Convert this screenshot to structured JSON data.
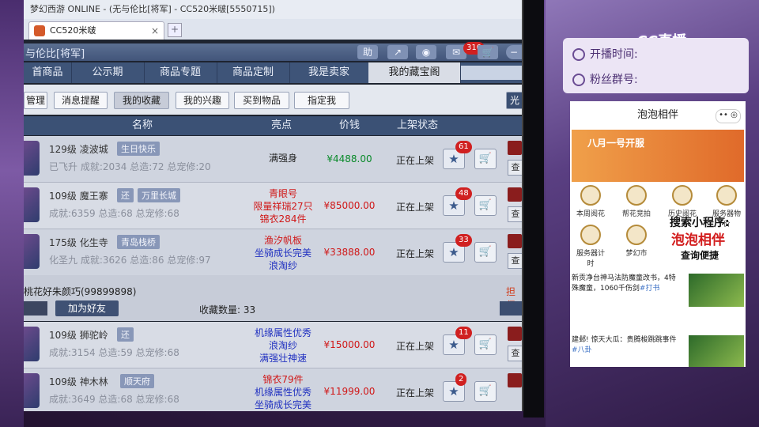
{
  "window": {
    "title": "梦幻西游 ONLINE - (无与伦比[将军] - CC520米啵[5550715])"
  },
  "browser": {
    "tab_label": "CC520米啵",
    "tab_close": "×",
    "new_tab": "+"
  },
  "game": {
    "server_title": "与伦比[将军]",
    "help_label": "助",
    "message_badge": "310"
  },
  "nav": {
    "items": [
      "首商品",
      "公示期",
      "商品专题",
      "商品定制",
      "我是卖家",
      "我的藏宝阁"
    ],
    "active_index": 5
  },
  "subnav": {
    "items": [
      "管理",
      "消息提醒",
      "我的收藏",
      "我的兴趣",
      "买到物品",
      "指定我"
    ],
    "selected_index": 2,
    "end_label": "光"
  },
  "table": {
    "headers": {
      "name": "名称",
      "highlight": "亮点",
      "price": "价钱",
      "status": "上架状态"
    },
    "rows": [
      {
        "level": "129级",
        "school": "凌波城",
        "tag": "生日快乐",
        "stats": "已飞升 成就:2034 总造:72 总宠修:20",
        "highlights": [
          "满强身"
        ],
        "price": "¥4488.00",
        "price_color": "#0a8a2a",
        "status": "正在上架",
        "favorites": "61"
      },
      {
        "level": "109级",
        "school": "魔王寨",
        "tag2": "还",
        "tag": "万里长城",
        "stats": "成就:6359 总造:68 总宠修:68",
        "highlights": [
          "青眼号",
          "限量祥瑞27只",
          "锦衣284件"
        ],
        "price": "¥85000.00",
        "price_color": "#d01818",
        "status": "正在上架",
        "favorites": "48"
      },
      {
        "level": "175级",
        "school": "化生寺",
        "tag": "青岛栈桥",
        "stats": "化圣九 成就:3626 总造:86 总宠修:97",
        "highlights": [
          "渔汐帆板",
          "坐骑成长完美",
          "浪淘纱"
        ],
        "price": "¥33888.00",
        "price_color": "#d01818",
        "status": "正在上架",
        "favorites": "33"
      }
    ],
    "rows2": [
      {
        "level": "109级",
        "school": "狮驼岭",
        "tag2": "还",
        "stats": "成就:3154 总造:59 总宠修:68",
        "highlights": [
          "机缘属性优秀",
          "浪淘纱",
          "满强壮神速"
        ],
        "price": "¥15000.00",
        "price_color": "#d01818",
        "status": "正在上架",
        "favorites": "11"
      },
      {
        "level": "109级",
        "school": "神木林",
        "tag": "顺天府",
        "stats": "成就:3649 总造:68 总宠修:68",
        "highlights": [
          "锦衣79件",
          "机缘属性优秀",
          "坐骑成长完美"
        ],
        "price": "¥11999.00",
        "price_color": "#d01818",
        "status": "正在上架",
        "favorites": "2"
      }
    ]
  },
  "group": {
    "seller": "桃花好朱颜巧(99899898)",
    "add_friend": "加为好友",
    "count_label": "收藏数量: 33",
    "right_link": "担保"
  },
  "live": {
    "logo": "CC直播",
    "start_time_label": "开播时间:",
    "fans_group_label": "粉丝群号:"
  },
  "miniapp": {
    "title": "泡泡相伴",
    "capsule": "•• ◎",
    "banner": "八月一号开服",
    "grid": [
      "本周阅花",
      "帮花竞拍",
      "历史阅花",
      "服务器物价",
      "服务器计时",
      "梦幻市"
    ],
    "promo": {
      "line1": "搜索小程序:",
      "line2": "泡泡相伴",
      "line3": "查询便捷"
    },
    "news": [
      {
        "text": "新贡净台神马法防魔童改书，4特殊魔童，1060千伤剑",
        "kw": "#打书"
      },
      {
        "text": "建邺! 惊天大瓜：贵腾梭跳跳事件",
        "kw": "#八卦"
      }
    ]
  }
}
